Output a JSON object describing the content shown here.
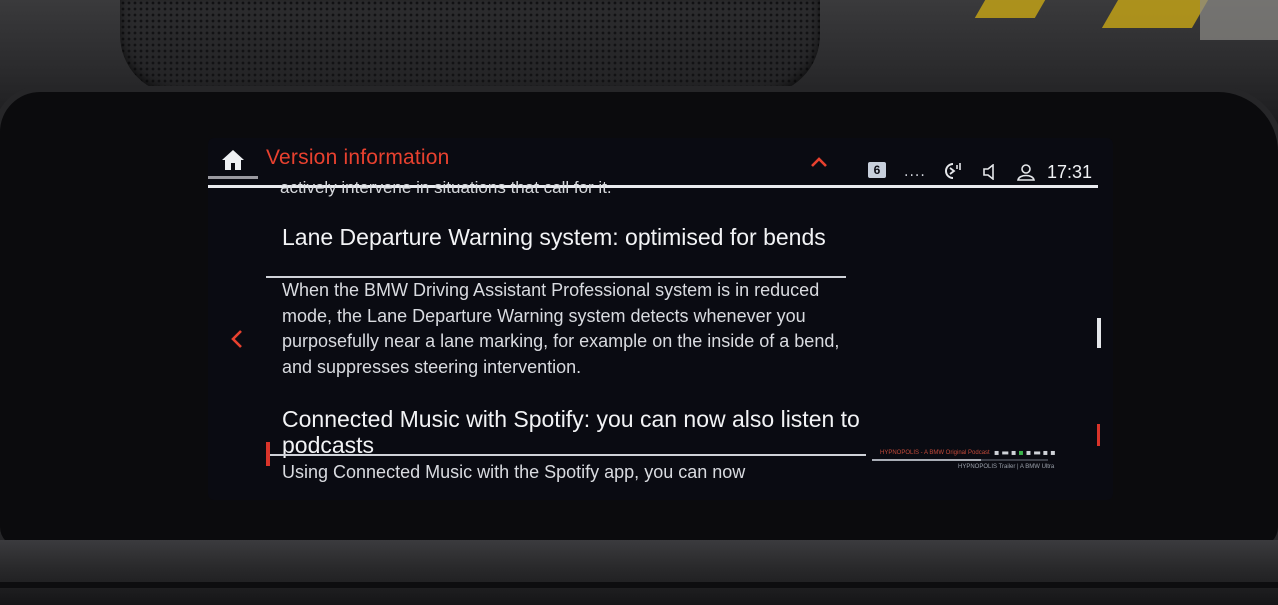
{
  "screen": {
    "title": "Version information",
    "status": {
      "badge": "6",
      "signal": "....",
      "time": "17:31"
    },
    "content": {
      "cut_line": "actively intervene in situations that call for it.",
      "sections": [
        {
          "heading": "Lane Departure Warning system: optimised for bends",
          "body": "When the BMW Driving Assistant Professional system is in reduced mode, the Lane Departure Warning system detects whenever you purposefully near a lane marking, for example on the inside of a bend, and suppresses steering intervention."
        },
        {
          "heading": "Connected Music with Spotify: you can now also listen to podcasts",
          "body": "Using Connected Music with the Spotify app, you can now"
        }
      ]
    },
    "music_widget": {
      "title_line": "HYPNOPOLIS - A BMW Original Podcast",
      "subtitle_line": "HYPNOPOLIS Trailer | A BMW Ultra",
      "progress": 0.62
    },
    "accent_color": "#e8412f"
  }
}
